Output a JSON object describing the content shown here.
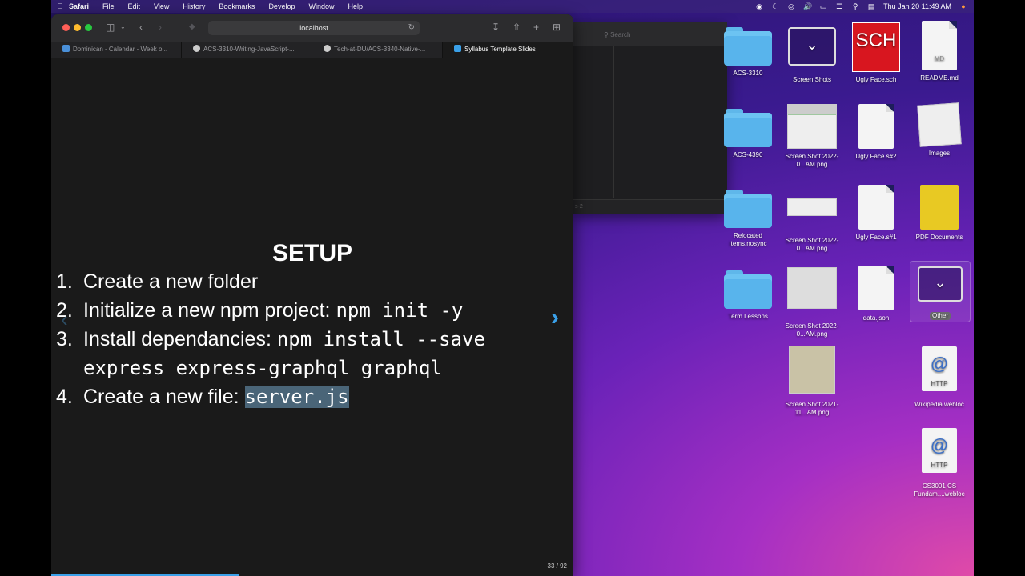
{
  "menubar": {
    "app": "Safari",
    "items": [
      "File",
      "Edit",
      "View",
      "History",
      "Bookmarks",
      "Develop",
      "Window",
      "Help"
    ],
    "clock": "Thu Jan 20  11:49 AM"
  },
  "browser": {
    "url": "localhost",
    "tabs": [
      {
        "label": "Dominican - Calendar - Week o...",
        "color": "#4a90d9"
      },
      {
        "label": "ACS-3310-Writing-JavaScript-...",
        "color": "#cccccc"
      },
      {
        "label": "Tech-at-DU/ACS-3340-Native-...",
        "color": "#cccccc"
      },
      {
        "label": "Syllabus Template Slides",
        "color": "#3aa0e8"
      }
    ]
  },
  "slide": {
    "title": "SETUP",
    "items": [
      {
        "num": "1.",
        "text": "Create a new folder",
        "code": ""
      },
      {
        "num": "2.",
        "text": "Initialize a new npm project: ",
        "code": "npm init -y"
      },
      {
        "num": "3.",
        "text": "Install dependancies: ",
        "code": "npm install --save",
        "code2": "express express-graphql graphql"
      },
      {
        "num": "4.",
        "text": "Create a new file: ",
        "code": "server.js"
      }
    ],
    "pager": "33 / 92",
    "progress": 0.36
  },
  "finder": {
    "search_placeholder": "Search",
    "status": "s-2"
  },
  "desktop": {
    "icons": [
      {
        "label": "ACS-3310",
        "kind": "folder"
      },
      {
        "label": "Screen Shots",
        "kind": "stack"
      },
      {
        "label": "Ugly Face.sch",
        "kind": "sch"
      },
      {
        "label": "README.md",
        "kind": "doc"
      },
      {
        "label": "ACS-4390",
        "kind": "folder"
      },
      {
        "label": "Screen Shot 2022-0...AM.png",
        "kind": "shot"
      },
      {
        "label": "Ugly Face.s#2",
        "kind": "doc"
      },
      {
        "label": "Images",
        "kind": "shot"
      },
      {
        "label": "Relocated Items.nosync",
        "kind": "folder"
      },
      {
        "label": "Screen Shot 2022-0...AM.png",
        "kind": "shot"
      },
      {
        "label": "Ugly Face.s#1",
        "kind": "doc"
      },
      {
        "label": "PDF Documents",
        "kind": "pdf"
      },
      {
        "label": "Term Lessons",
        "kind": "folder"
      },
      {
        "label": "Screen Shot 2022-0...AM.png",
        "kind": "shot"
      },
      {
        "label": "data.json",
        "kind": "doc"
      },
      {
        "label": "Other",
        "kind": "stack"
      },
      {
        "label": "Screen Shot 2021-11...AM.png",
        "kind": "shot"
      },
      {
        "label": "Wikipedia.webloc",
        "kind": "http"
      },
      {
        "label": "CS3001 CS Fundam....webloc",
        "kind": "http"
      }
    ],
    "sch_text": "SCH",
    "md_text": "MD",
    "http_text": "HTTP",
    "at_sign": "@"
  }
}
